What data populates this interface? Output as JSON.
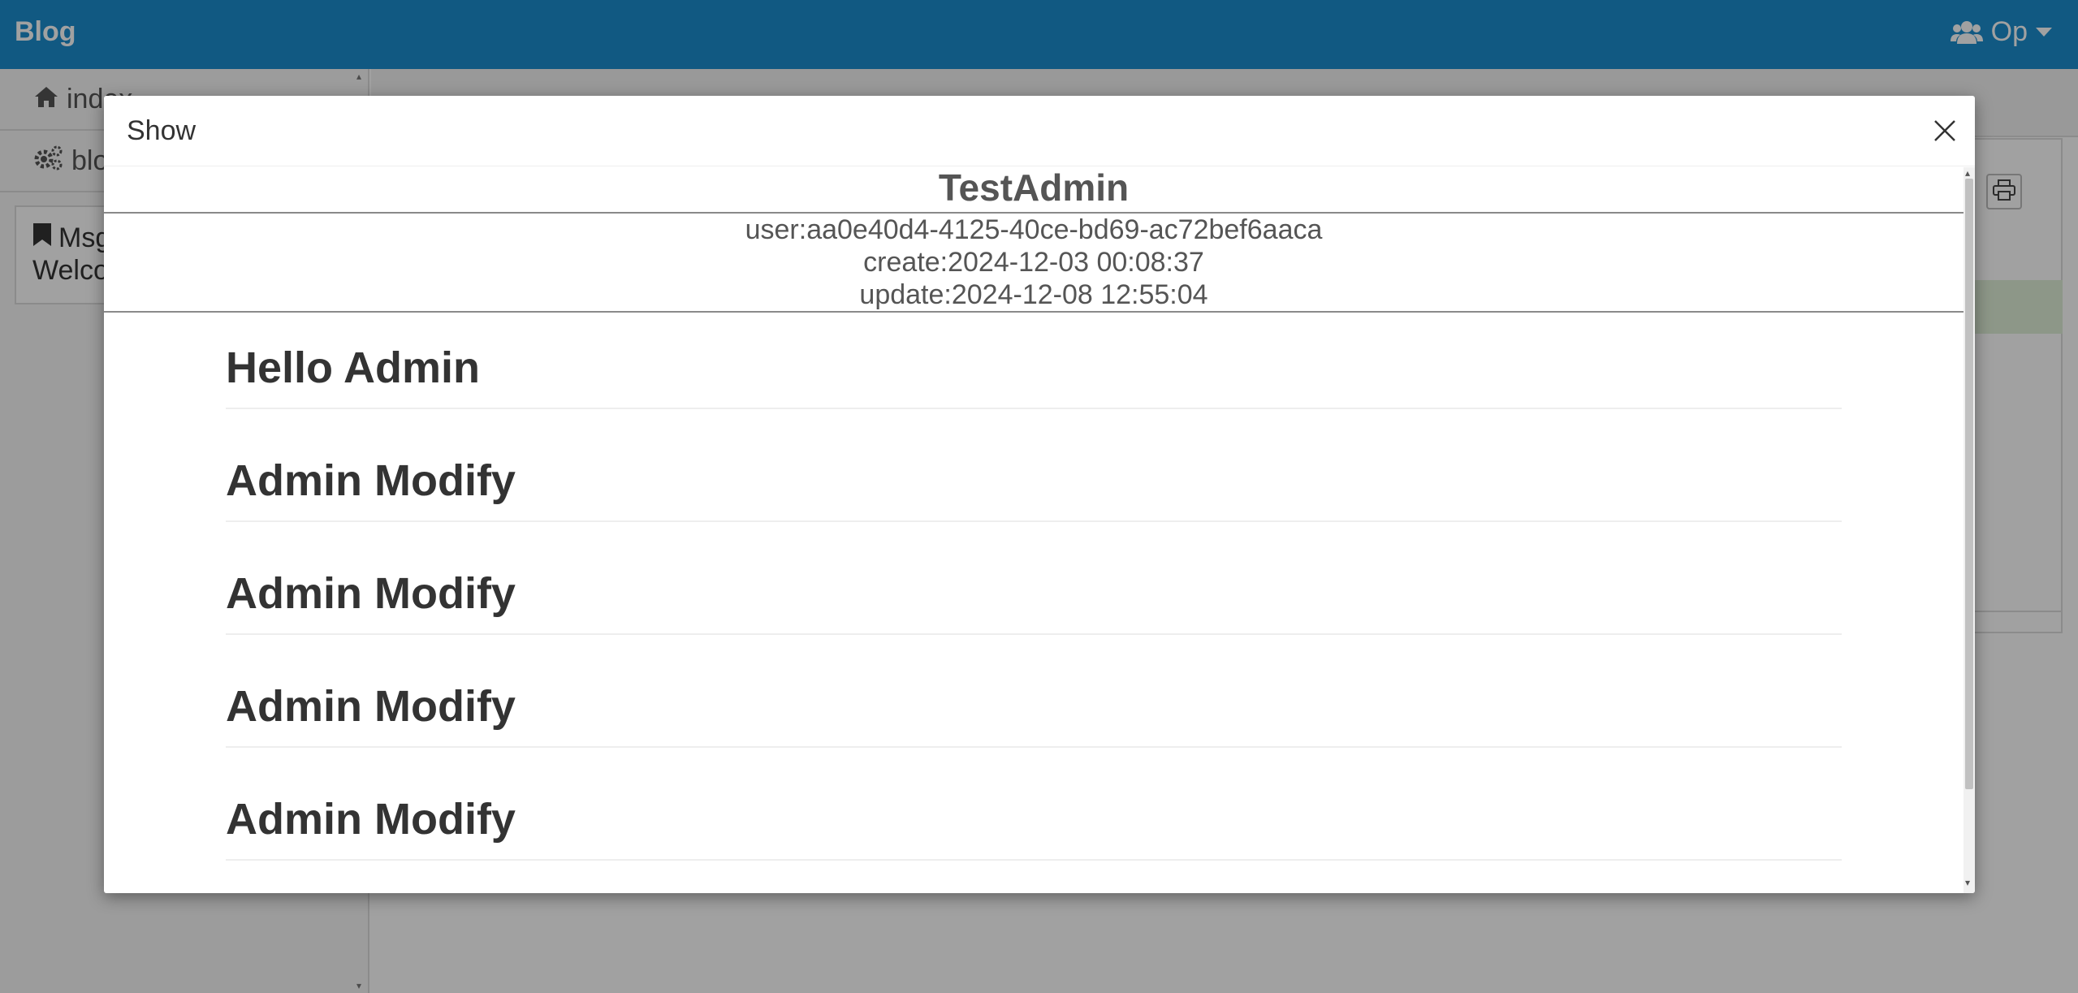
{
  "app": {
    "brand": "Blog",
    "accent": "#1b8ecf"
  },
  "user_menu": {
    "label": "Op",
    "icon": "users-icon"
  },
  "sidebar": {
    "items": [
      {
        "label": "index",
        "icon": "home-icon"
      },
      {
        "label": "blog",
        "icon": "gears-icon"
      }
    ],
    "msg_box": {
      "title": "Msg",
      "text": "Welcome",
      "icon": "bookmark-icon"
    }
  },
  "modal": {
    "title": "Show",
    "post": {
      "name": "TestAdmin",
      "user": "user:aa0e40d4-4125-40ce-bd69-ac72bef6aaca",
      "create": "create:2024-12-03 00:08:37",
      "update": "update:2024-12-08 12:55:04"
    },
    "content_headings": [
      "Hello Admin",
      "Admin Modify",
      "Admin Modify",
      "Admin Modify",
      "Admin Modify"
    ]
  }
}
